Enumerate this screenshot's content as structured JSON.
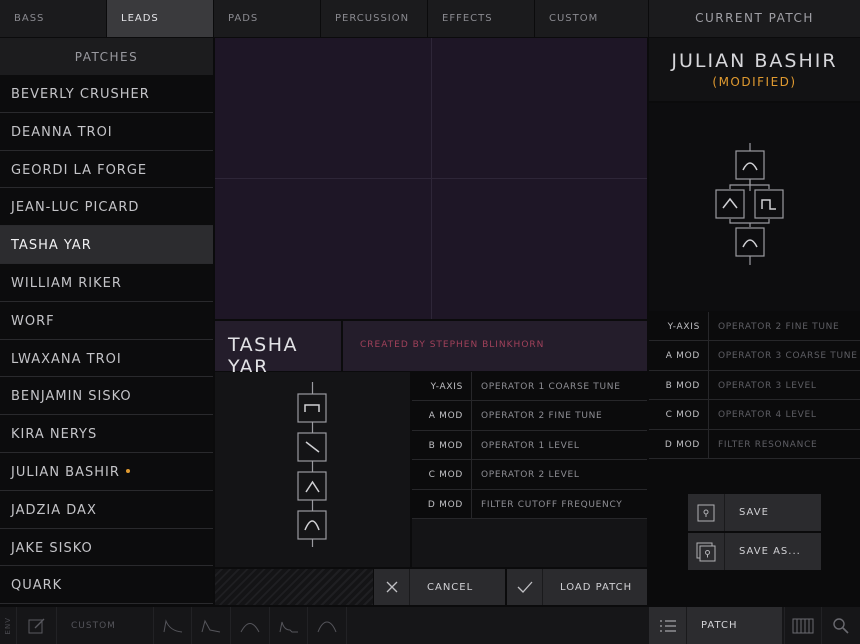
{
  "tabs": [
    {
      "label": "BASS"
    },
    {
      "label": "LEADS"
    },
    {
      "label": "PADS"
    },
    {
      "label": "PERCUSSION"
    },
    {
      "label": "EFFECTS"
    },
    {
      "label": "CUSTOM"
    }
  ],
  "patches_header": "PATCHES",
  "patches": [
    {
      "label": "BEVERLY CRUSHER"
    },
    {
      "label": "DEANNA TROI"
    },
    {
      "label": "GEORDI LA FORGE"
    },
    {
      "label": "JEAN-LUC PICARD"
    },
    {
      "label": "TASHA YAR"
    },
    {
      "label": "WILLIAM RIKER"
    },
    {
      "label": "WORF"
    },
    {
      "label": "LWAXANA TROI"
    },
    {
      "label": "BENJAMIN SISKO"
    },
    {
      "label": "KIRA NERYS"
    },
    {
      "label": "JULIAN BASHIR"
    },
    {
      "label": "JADZIA DAX"
    },
    {
      "label": "JAKE SISKO"
    },
    {
      "label": "QUARK"
    }
  ],
  "preview": {
    "name": "TASHA YAR",
    "created_by": "CREATED BY STEPHEN BLINKHORN",
    "mods": [
      {
        "key": "Y-AXIS",
        "value": "OPERATOR 1 COARSE TUNE"
      },
      {
        "key": "A MOD",
        "value": "OPERATOR 2 FINE TUNE"
      },
      {
        "key": "B MOD",
        "value": "OPERATOR 1 LEVEL"
      },
      {
        "key": "C MOD",
        "value": "OPERATOR 2 LEVEL"
      },
      {
        "key": "D MOD",
        "value": "FILTER CUTOFF FREQUENCY"
      }
    ],
    "cancel_label": "CANCEL",
    "load_label": "LOAD PATCH"
  },
  "current": {
    "title": "CURRENT PATCH",
    "name": "JULIAN BASHIR",
    "modified": "(MODIFIED)",
    "mods": [
      {
        "key": "Y-AXIS",
        "value": "OPERATOR 2 FINE TUNE"
      },
      {
        "key": "A MOD",
        "value": "OPERATOR 3 COARSE TUNE"
      },
      {
        "key": "B MOD",
        "value": "OPERATOR 3 LEVEL"
      },
      {
        "key": "C MOD",
        "value": "OPERATOR 4 LEVEL"
      },
      {
        "key": "D MOD",
        "value": "FILTER RESONANCE"
      }
    ],
    "save_label": "SAVE",
    "save_as_label": "SAVE AS..."
  },
  "bottom": {
    "env_label": "ENV",
    "custom_label": "CUSTOM",
    "patch_label": "PATCH"
  },
  "colors": {
    "accent": "#e09a30",
    "author": "#a0415a",
    "xy_pad": "#1e1626"
  }
}
